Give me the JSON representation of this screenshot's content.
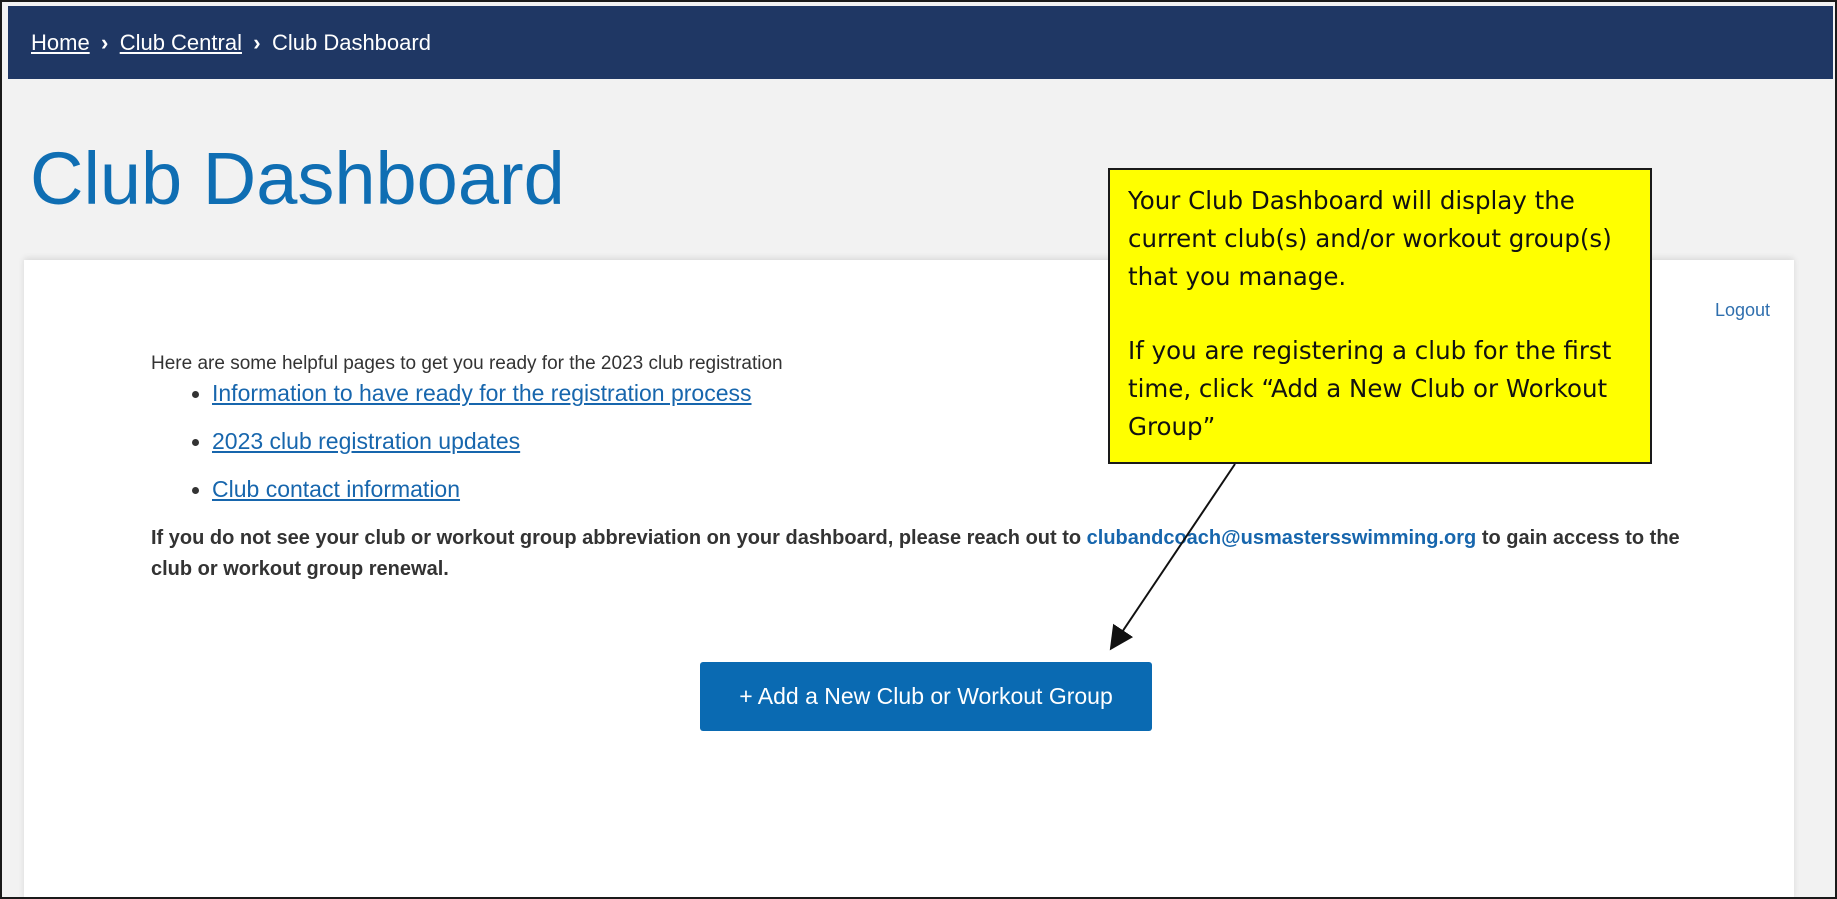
{
  "breadcrumb": {
    "home": "Home",
    "club_central": "Club Central",
    "current": "Club Dashboard"
  },
  "page_title": "Club Dashboard",
  "logout_label": "Logout",
  "intro_text": "Here are some helpful pages to get you ready for the 2023 club registration",
  "links": [
    {
      "label": "Information to have ready for the registration process"
    },
    {
      "label": "2023 club registration updates"
    },
    {
      "label": "Club contact information"
    }
  ],
  "notice": {
    "before": "If you do not see your club or workout group abbreviation on your dashboard, please reach out to ",
    "email": "clubandcoach@usmastersswimming.org",
    "after": " to gain access to the club or workout group renewal."
  },
  "add_button_label": "+ Add a New Club or Workout Group",
  "callout": {
    "paragraph1": "Your Club Dashboard will display the current club(s) and/or workout group(s) that you manage.",
    "paragraph2": "If you are registering a club for the first time, click “Add a New Club or Workout Group”"
  },
  "colors": {
    "topbar": "#1f3764",
    "title": "#0f6eb3",
    "button": "#0a6ab2",
    "link": "#1766ad",
    "callout": "#ffff00"
  }
}
